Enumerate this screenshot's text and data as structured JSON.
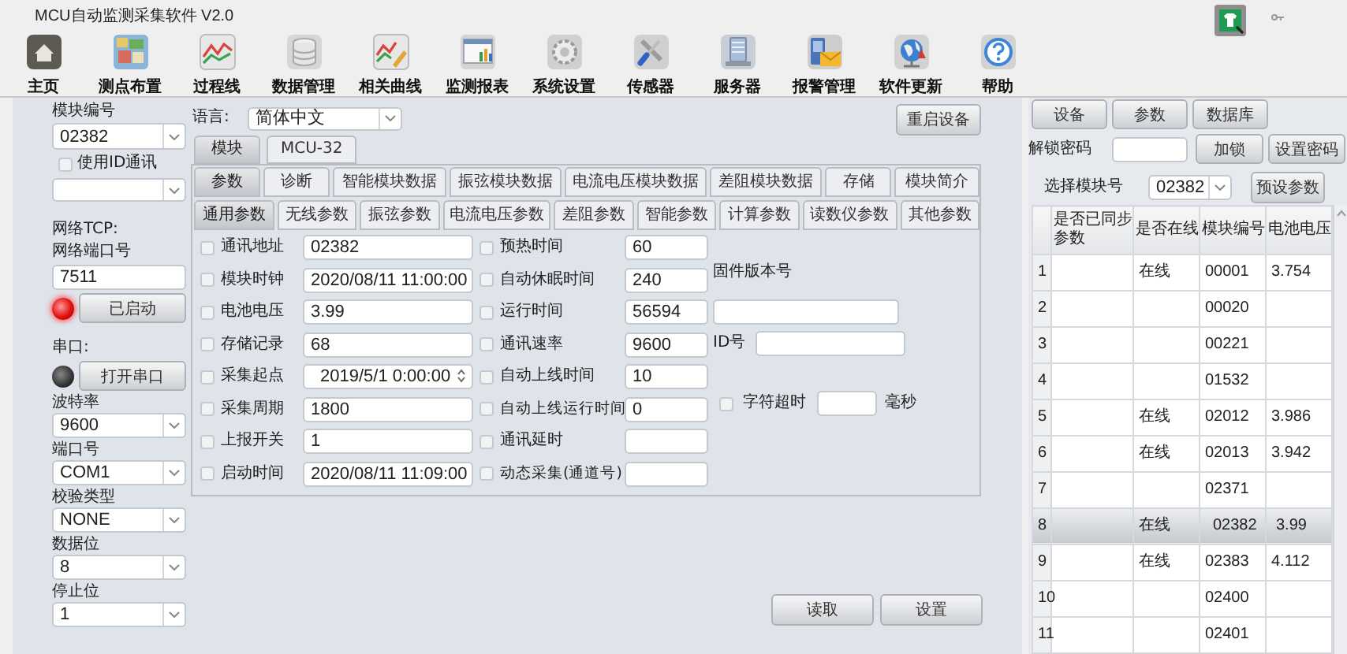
{
  "window": {
    "title": "MCU自动监测采集软件 V2.0"
  },
  "toolbar": [
    {
      "label": "主页"
    },
    {
      "label": "测点布置"
    },
    {
      "label": "过程线"
    },
    {
      "label": "数据管理"
    },
    {
      "label": "相关曲线"
    },
    {
      "label": "监测报表"
    },
    {
      "label": "系统设置"
    },
    {
      "label": "传感器"
    },
    {
      "label": "服务器"
    },
    {
      "label": "报警管理"
    },
    {
      "label": "软件更新"
    },
    {
      "label": "帮助"
    }
  ],
  "left_panel": {
    "module_number": {
      "label": "模块编号",
      "value": "02382"
    },
    "use_id": {
      "label": "使用ID通讯",
      "checked": false
    },
    "network": {
      "heading": "网络TCP:",
      "port_label": "网络端口号",
      "port": "7511",
      "running": true,
      "button": "已启动"
    },
    "serial": {
      "heading": "串口:",
      "open": false,
      "button": "打开串口"
    },
    "serial_settings": [
      {
        "label": "波特率",
        "value": "9600"
      },
      {
        "label": "端口号",
        "value": "COM1"
      },
      {
        "label": "校验类型",
        "value": "NONE"
      },
      {
        "label": "数据位",
        "value": "8"
      },
      {
        "label": "停止位",
        "value": "1"
      }
    ]
  },
  "main_panel": {
    "language": {
      "label": "语言:",
      "value": "简体中文"
    },
    "restart_button": "重启设备",
    "module_tabs": [
      {
        "label": "模块",
        "selected": true
      },
      {
        "label": "MCU-32",
        "selected": false
      }
    ],
    "tabs": [
      {
        "label": "参数",
        "selected": true
      },
      {
        "label": "诊断",
        "selected": false
      },
      {
        "label": "智能模块数据",
        "selected": false
      },
      {
        "label": "振弦模块数据",
        "selected": false
      },
      {
        "label": "电流电压模块数据",
        "selected": false
      },
      {
        "label": "差阻模块数据",
        "selected": false
      },
      {
        "label": "存储",
        "selected": false
      },
      {
        "label": "模块简介",
        "selected": false
      }
    ],
    "sub_tabs": [
      {
        "label": "通用参数",
        "selected": true
      },
      {
        "label": "无线参数",
        "selected": false
      },
      {
        "label": "振弦参数",
        "selected": false
      },
      {
        "label": "电流电压参数",
        "selected": false
      },
      {
        "label": "差阻参数",
        "selected": false
      },
      {
        "label": "智能参数",
        "selected": false
      },
      {
        "label": "计算参数",
        "selected": false
      },
      {
        "label": "读数仪参数",
        "selected": false
      },
      {
        "label": "其他参数",
        "selected": false
      }
    ],
    "params_left": [
      {
        "label": "通讯地址",
        "value": "02382",
        "checked": false,
        "kind": "text"
      },
      {
        "label": "模块时钟",
        "value": "2020/08/11 11:00:00",
        "checked": false,
        "kind": "text"
      },
      {
        "label": "电池电压",
        "value": "3.99",
        "checked": false,
        "kind": "text"
      },
      {
        "label": "存储记录",
        "value": "68",
        "checked": false,
        "kind": "text"
      },
      {
        "label": "采集起点",
        "value": "2019/5/1 0:00:00",
        "checked": false,
        "kind": "spin"
      },
      {
        "label": "采集周期",
        "value": "1800",
        "checked": false,
        "kind": "text"
      },
      {
        "label": "上报开关",
        "value": "1",
        "checked": false,
        "kind": "text"
      },
      {
        "label": "启动时间",
        "value": "2020/08/11 11:09:00",
        "checked": false,
        "kind": "text"
      }
    ],
    "params_right": [
      {
        "label": "预热时间",
        "value": "60",
        "checked": false
      },
      {
        "label": "自动休眠时间",
        "value": "240",
        "checked": false
      },
      {
        "label": "运行时间",
        "value": "56594",
        "checked": false
      },
      {
        "label": "通讯速率",
        "value": "9600",
        "checked": false
      },
      {
        "label": "自动上线时间",
        "value": "10",
        "checked": false
      },
      {
        "label": "自动上线运行时间",
        "value": "0",
        "checked": false
      },
      {
        "label": "通讯延时",
        "checked": false
      },
      {
        "label": "动态采集(通道号)",
        "checked": false
      }
    ],
    "firmware": {
      "label": "固件版本号"
    },
    "id": {
      "label": "ID号"
    },
    "char_timeout": {
      "label": "字符超时",
      "checked": false,
      "unit": "毫秒"
    },
    "buttons": [
      "读取",
      "设置"
    ]
  },
  "right_panel": {
    "tabs": [
      "设备",
      "参数",
      "数据库"
    ],
    "unlock": {
      "label": "解锁密码",
      "lock_button": "加锁",
      "set_button": "设置密码"
    },
    "module_select": {
      "label": "选择模块号",
      "value": "02382",
      "button": "预设参数"
    },
    "table": {
      "columns": [
        "是否已同步参数",
        "是否在线",
        "模块编号",
        "电池电压"
      ],
      "rows": [
        {
          "number": "1",
          "online": "在线",
          "module": "00001",
          "voltage": "3.754",
          "selected": false
        },
        {
          "number": "2",
          "module": "00020",
          "selected": false
        },
        {
          "number": "3",
          "module": "00221",
          "selected": false
        },
        {
          "number": "4",
          "module": "01532",
          "selected": false
        },
        {
          "number": "5",
          "online": "在线",
          "module": "02012",
          "voltage": "3.986",
          "selected": false
        },
        {
          "number": "6",
          "online": "在线",
          "module": "02013",
          "voltage": "3.942",
          "selected": false
        },
        {
          "number": "7",
          "module": "02371",
          "selected": false
        },
        {
          "number": "8",
          "online": "在线",
          "module": "02382",
          "voltage": "3.99",
          "selected": true
        },
        {
          "number": "9",
          "online": "在线",
          "module": "02383",
          "voltage": "4.112",
          "selected": false
        },
        {
          "number": "10",
          "module": "02400",
          "selected": false
        },
        {
          "number": "11",
          "module": "02401",
          "selected": false
        }
      ]
    }
  }
}
